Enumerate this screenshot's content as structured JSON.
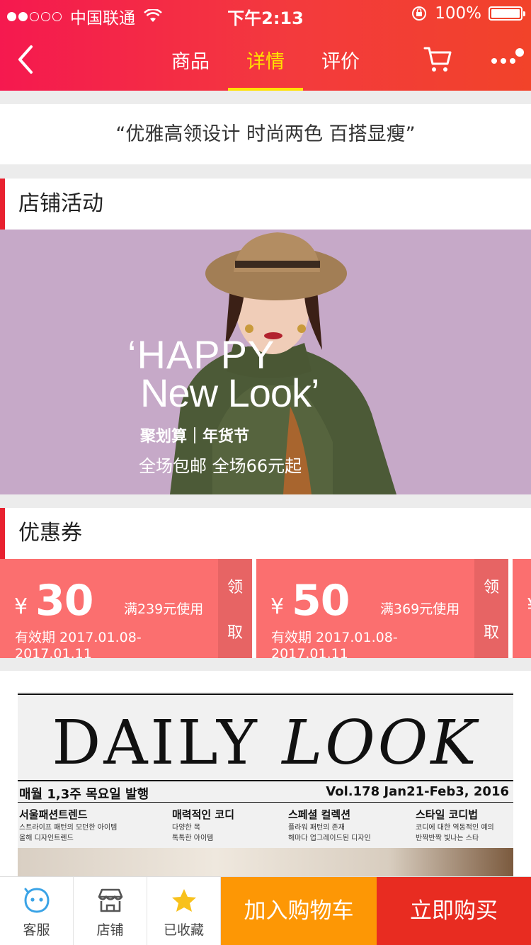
{
  "status_bar": {
    "carrier": "中国联通",
    "time": "下午2:13",
    "battery": "100%"
  },
  "nav": {
    "tabs": [
      {
        "label": "商品",
        "active": false
      },
      {
        "label": "详情",
        "active": true
      },
      {
        "label": "评价",
        "active": false
      }
    ]
  },
  "slogan": "“优雅高领设计 时尚两色 百搭显瘦”",
  "shop_activity": {
    "title": "店铺活动",
    "banner": {
      "headline_1": "‘HAPPY",
      "headline_2": "New Look’",
      "brand": "聚划算｜年货节",
      "promo": "全场包邮 全场66元起"
    }
  },
  "coupons": {
    "title": "优惠券",
    "items": [
      {
        "currency": "¥",
        "amount": "30",
        "condition": "满239元使用",
        "validity": "有效期 2017.01.08-2017.01.11",
        "claim_1": "领",
        "claim_2": "取"
      },
      {
        "currency": "¥",
        "amount": "50",
        "condition": "满369元使用",
        "validity": "有效期 2017.01.08-2017.01.11",
        "claim_1": "领",
        "claim_2": "取"
      }
    ],
    "partial_currency": "¥"
  },
  "daily_look": {
    "masthead_1": "DAILY",
    "masthead_2": "LOOK",
    "issue": "매월 1,3주 목요일 발행",
    "volume": "Vol.178 Jan21-Feb3, 2016",
    "columns": [
      {
        "head": "서울패션트렌드",
        "sub1": "스트라이프 패턴의 모던한 아이템",
        "sub2": "올해 디자인트렌드"
      },
      {
        "head": "매력적인 코디",
        "sub1": "다양한 목",
        "sub2": "톡톡한 아이템"
      },
      {
        "head": "스페셜 컬렉션",
        "sub1": "플라워 패턴의 존재",
        "sub2": "해마다 업그레이드된 디자인"
      },
      {
        "head": "스타일 코디법",
        "sub1": "코디에 대한 역동적인 예의",
        "sub2": "반짝반짝 빛나는 스타"
      }
    ]
  },
  "bottom_bar": {
    "service": "客服",
    "shop": "店铺",
    "favorited": "已收藏",
    "add_to_cart": "加入购物车",
    "buy_now": "立即购买"
  },
  "colors": {
    "header_start": "#f5194f",
    "header_end": "#f2432a",
    "active_tab": "#ffe100",
    "accent_red": "#e8212f",
    "coupon": "#fb6f6f",
    "add_to_cart": "#fd9705",
    "buy_now": "#e82c21"
  }
}
